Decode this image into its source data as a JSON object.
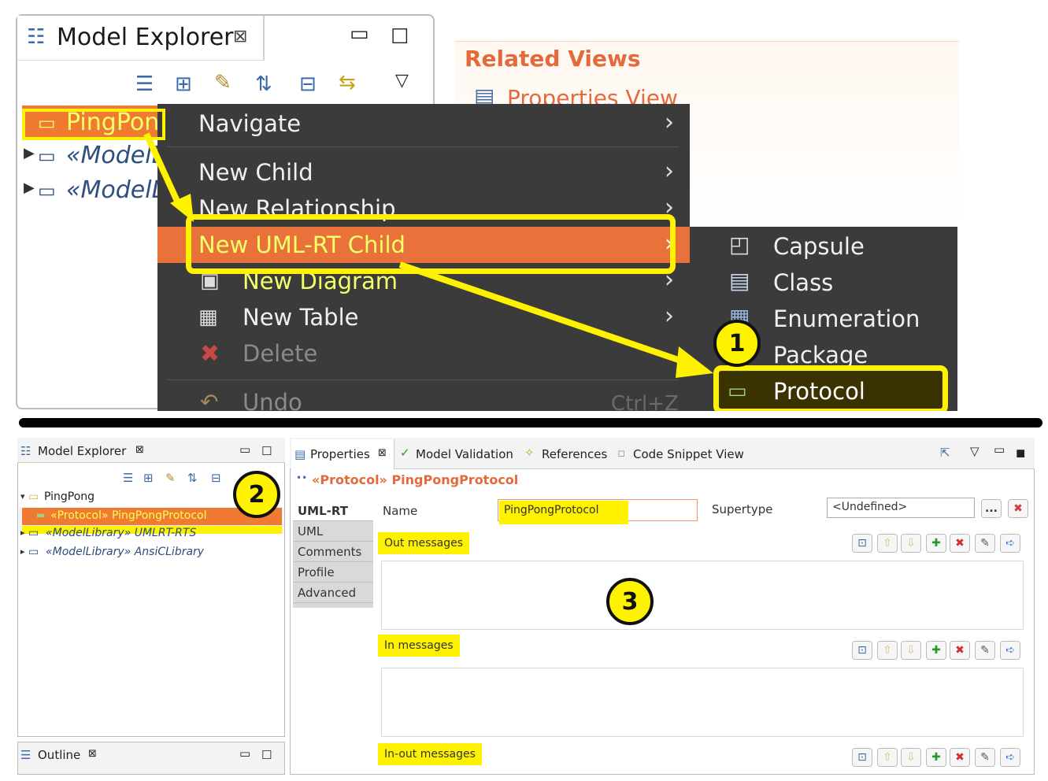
{
  "top": {
    "model_explorer": {
      "title": "Model Explorer",
      "close_glyph": "⊠",
      "minimize_glyph": "▭",
      "maximize_glyph": "☐",
      "view_menu_glyph": "▽",
      "tree": [
        {
          "label": "PingPong",
          "state": "selected"
        },
        {
          "label": "«ModelL",
          "state": "collapsed"
        },
        {
          "label": "«ModelL",
          "state": "collapsed"
        }
      ]
    },
    "related_views": {
      "title": "Related Views",
      "item": "Properties View"
    },
    "context_menu": {
      "items": [
        "Navigate",
        "New Child",
        "New Relationship",
        "New UML-RT Child",
        "New Diagram",
        "New Table",
        "Delete",
        "Undo"
      ],
      "shortcut_undo": "Ctrl+Z",
      "highlighted": "New UML-RT Child"
    },
    "submenu": {
      "items": [
        "Capsule",
        "Class",
        "Enumeration",
        "Package",
        "Protocol"
      ],
      "highlighted": "Protocol"
    },
    "callout_1": "1"
  },
  "bottom": {
    "model_explorer": {
      "title": "Model Explorer",
      "tree": [
        {
          "label": "PingPong"
        },
        {
          "label": "«Protocol» PingPongProtocol",
          "state": "selected"
        },
        {
          "label": "«ModelLibrary» UMLRT-RTS"
        },
        {
          "label": "«ModelLibrary» AnsiCLibrary"
        }
      ]
    },
    "outline": {
      "title": "Outline"
    },
    "properties": {
      "tabs": [
        "Properties",
        "Model Validation",
        "References",
        "Code Snippet View"
      ],
      "title": "«Protocol» PingPongProtocol",
      "left_tabs": [
        "UML-RT",
        "UML",
        "Comments",
        "Profile",
        "Advanced"
      ],
      "active_tab": "UML-RT",
      "name_label": "Name",
      "name_value": "PingPongProtocol",
      "supertype_label": "Supertype",
      "supertype_value": "<Undefined>",
      "supertype_browse": "...",
      "sections": [
        "Out messages",
        "In messages",
        "In-out messages"
      ]
    },
    "callout_2": "2",
    "callout_3": "3"
  },
  "colors": {
    "highlight_orange": "#f07a31",
    "callout_yellow": "#fff200",
    "menu_bg": "#3b3b3b",
    "related_title": "#e36a3a"
  }
}
